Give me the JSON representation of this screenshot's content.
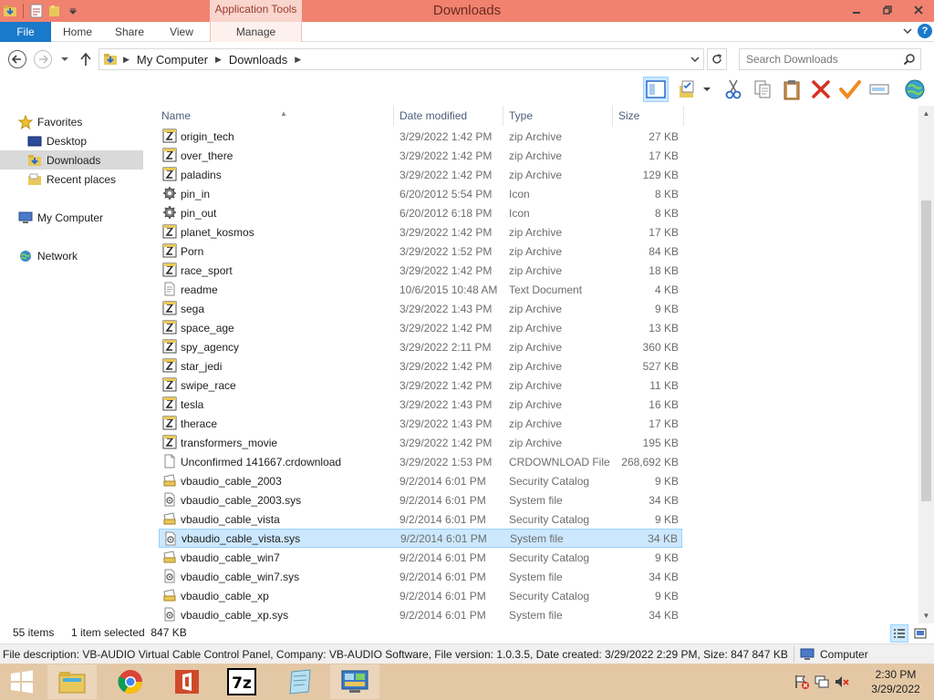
{
  "window": {
    "title": "Downloads",
    "context_tab": "Application Tools"
  },
  "ribbon": {
    "tabs": [
      "File",
      "Home",
      "Share",
      "View",
      "Manage"
    ]
  },
  "address": {
    "crumbs": [
      "My Computer",
      "Downloads"
    ],
    "search_placeholder": "Search Downloads"
  },
  "nav": {
    "favorites": "Favorites",
    "desktop": "Desktop",
    "downloads": "Downloads",
    "recent": "Recent places",
    "computer": "My Computer",
    "network": "Network"
  },
  "columns": {
    "name": "Name",
    "date": "Date modified",
    "type": "Type",
    "size": "Size"
  },
  "files": [
    {
      "name": "origin_tech",
      "date": "3/29/2022 1:42 PM",
      "type": "zip Archive",
      "size": "27 KB",
      "icon": "zip"
    },
    {
      "name": "over_there",
      "date": "3/29/2022 1:42 PM",
      "type": "zip Archive",
      "size": "17 KB",
      "icon": "zip"
    },
    {
      "name": "paladins",
      "date": "3/29/2022 1:42 PM",
      "type": "zip Archive",
      "size": "129 KB",
      "icon": "zip"
    },
    {
      "name": "pin_in",
      "date": "6/20/2012 5:54 PM",
      "type": "Icon",
      "size": "8 KB",
      "icon": "gear"
    },
    {
      "name": "pin_out",
      "date": "6/20/2012 6:18 PM",
      "type": "Icon",
      "size": "8 KB",
      "icon": "gear"
    },
    {
      "name": "planet_kosmos",
      "date": "3/29/2022 1:42 PM",
      "type": "zip Archive",
      "size": "17 KB",
      "icon": "zip"
    },
    {
      "name": "Porn",
      "date": "3/29/2022 1:52 PM",
      "type": "zip Archive",
      "size": "84 KB",
      "icon": "zip"
    },
    {
      "name": "race_sport",
      "date": "3/29/2022 1:42 PM",
      "type": "zip Archive",
      "size": "18 KB",
      "icon": "zip"
    },
    {
      "name": "readme",
      "date": "10/6/2015 10:48 AM",
      "type": "Text Document",
      "size": "4 KB",
      "icon": "text"
    },
    {
      "name": "sega",
      "date": "3/29/2022 1:43 PM",
      "type": "zip Archive",
      "size": "9 KB",
      "icon": "zip"
    },
    {
      "name": "space_age",
      "date": "3/29/2022 1:42 PM",
      "type": "zip Archive",
      "size": "13 KB",
      "icon": "zip"
    },
    {
      "name": "spy_agency",
      "date": "3/29/2022 2:11 PM",
      "type": "zip Archive",
      "size": "360 KB",
      "icon": "zip"
    },
    {
      "name": "star_jedi",
      "date": "3/29/2022 1:42 PM",
      "type": "zip Archive",
      "size": "527 KB",
      "icon": "zip"
    },
    {
      "name": "swipe_race",
      "date": "3/29/2022 1:42 PM",
      "type": "zip Archive",
      "size": "11 KB",
      "icon": "zip"
    },
    {
      "name": "tesla",
      "date": "3/29/2022 1:43 PM",
      "type": "zip Archive",
      "size": "16 KB",
      "icon": "zip"
    },
    {
      "name": "therace",
      "date": "3/29/2022 1:43 PM",
      "type": "zip Archive",
      "size": "17 KB",
      "icon": "zip"
    },
    {
      "name": "transformers_movie",
      "date": "3/29/2022 1:42 PM",
      "type": "zip Archive",
      "size": "195 KB",
      "icon": "zip"
    },
    {
      "name": "Unconfirmed 141667.crdownload",
      "date": "3/29/2022 1:53 PM",
      "type": "CRDOWNLOAD File",
      "size": "268,692 KB",
      "icon": "blank"
    },
    {
      "name": "vbaudio_cable_2003",
      "date": "9/2/2014 6:01 PM",
      "type": "Security Catalog",
      "size": "9 KB",
      "icon": "catalog"
    },
    {
      "name": "vbaudio_cable_2003.sys",
      "date": "9/2/2014 6:01 PM",
      "type": "System file",
      "size": "34 KB",
      "icon": "sys"
    },
    {
      "name": "vbaudio_cable_vista",
      "date": "9/2/2014 6:01 PM",
      "type": "Security Catalog",
      "size": "9 KB",
      "icon": "catalog"
    },
    {
      "name": "vbaudio_cable_vista.sys",
      "date": "9/2/2014 6:01 PM",
      "type": "System file",
      "size": "34 KB",
      "icon": "sys",
      "selected": true
    },
    {
      "name": "vbaudio_cable_win7",
      "date": "9/2/2014 6:01 PM",
      "type": "Security Catalog",
      "size": "9 KB",
      "icon": "catalog"
    },
    {
      "name": "vbaudio_cable_win7.sys",
      "date": "9/2/2014 6:01 PM",
      "type": "System file",
      "size": "34 KB",
      "icon": "sys"
    },
    {
      "name": "vbaudio_cable_xp",
      "date": "9/2/2014 6:01 PM",
      "type": "Security Catalog",
      "size": "9 KB",
      "icon": "catalog"
    },
    {
      "name": "vbaudio_cable_xp.sys",
      "date": "9/2/2014 6:01 PM",
      "type": "System file",
      "size": "34 KB",
      "icon": "sys"
    }
  ],
  "status": {
    "items": "55 items",
    "selected": "1 item selected  847 KB"
  },
  "description": {
    "text": "File description: VB-AUDIO Virtual Cable Control Panel, Company: VB-AUDIO Software, File version: 1.0.3.5, Date created: 3/29/2022 2:29 PM, Size: 847 847 KB",
    "computer": "Computer"
  },
  "taskbar": {
    "time": "2:30 PM",
    "date": "3/29/2022"
  },
  "colors": {
    "titlebar": "#f0826f",
    "file_tab": "#1979ca",
    "selection": "#cce8ff",
    "taskbar": "#e4c8a6"
  }
}
